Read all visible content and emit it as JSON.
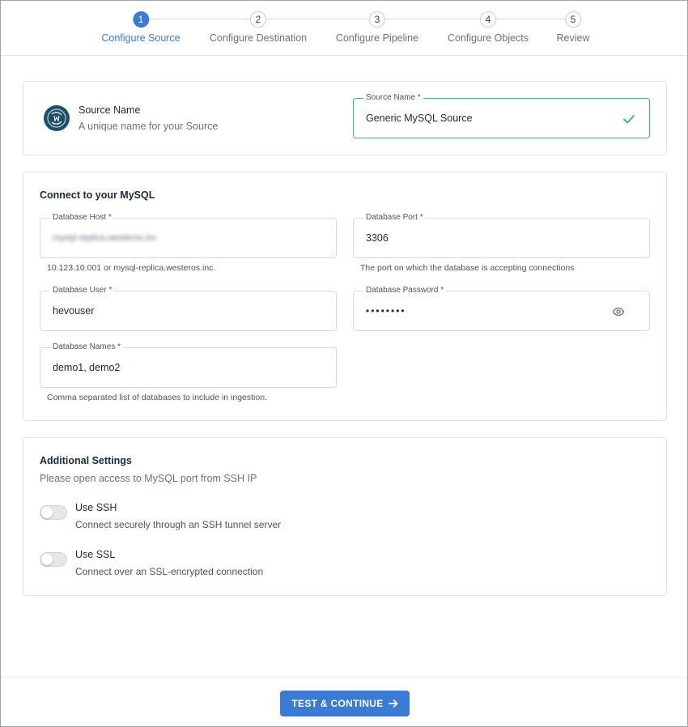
{
  "stepper": {
    "steps": [
      {
        "number": "1",
        "label": "Configure Source",
        "active": true
      },
      {
        "number": "2",
        "label": "Configure Destination",
        "active": false
      },
      {
        "number": "3",
        "label": "Configure Pipeline",
        "active": false
      },
      {
        "number": "4",
        "label": "Configure Objects",
        "active": false
      },
      {
        "number": "5",
        "label": "Review",
        "active": false
      }
    ]
  },
  "source": {
    "title": "Source Name",
    "subtitle": "A unique name for your Source",
    "field_label": "Source Name *",
    "field_value": "Generic MySQL Source",
    "logo_icon": "mysql-logo-icon",
    "valid_icon": "check-icon"
  },
  "connect": {
    "title": "Connect to your MySQL",
    "host": {
      "label": "Database Host *",
      "value": "mysql-replica.westeros.inc",
      "hint": "10.123.10.001 or mysql-replica.westeros.inc."
    },
    "port": {
      "label": "Database Port *",
      "value": "3306",
      "hint": "The port on which the database is accepting connections"
    },
    "user": {
      "label": "Database User *",
      "value": "hevouser"
    },
    "password": {
      "label": "Database Password *",
      "value": "••••••••",
      "toggle_icon": "eye-icon"
    },
    "names": {
      "label": "Database Names *",
      "value": "demo1, demo2",
      "hint": "Comma separated list of databases to include in ingestion."
    }
  },
  "additional": {
    "title": "Additional Settings",
    "subtitle": "Please open access to MySQL port from SSH IP",
    "ssh": {
      "title": "Use SSH",
      "subtitle": "Connect securely through an SSH tunnel server",
      "enabled": false
    },
    "ssl": {
      "title": "Use SSL",
      "subtitle": "Connect over an SSL-encrypted connection",
      "enabled": false
    }
  },
  "footer": {
    "primary_label": "TEST & CONTINUE",
    "primary_icon": "arrow-right-icon"
  },
  "colors": {
    "accent": "#3a7bd5",
    "valid": "#38b2a0"
  }
}
